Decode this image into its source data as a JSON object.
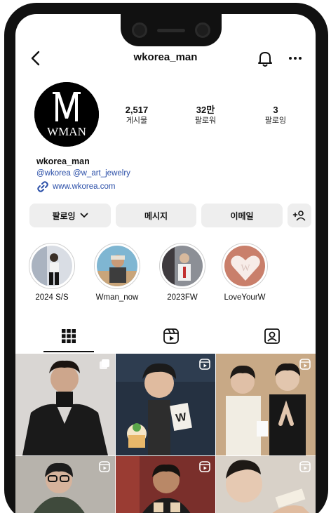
{
  "header": {
    "handle": "wkorea_man"
  },
  "profile": {
    "logo_text": "WMAN",
    "stats": [
      {
        "value": "2,517",
        "label": "게시물"
      },
      {
        "value": "32만",
        "label": "팔로워"
      },
      {
        "value": "3",
        "label": "팔로잉"
      }
    ],
    "name": "wkorea_man",
    "tags": "@wkorea @w_art_jewelry",
    "link": "www.wkorea.com"
  },
  "actions": {
    "following_label": "팔로잉",
    "message_label": "메시지",
    "email_label": "이메일"
  },
  "highlights": [
    {
      "label": "2024 S/S"
    },
    {
      "label": "Wman_now"
    },
    {
      "label": "2023FW"
    },
    {
      "label": "LoveYourW"
    }
  ],
  "grid_posts": [
    {
      "type": "carousel",
      "icon": "carousel-icon"
    },
    {
      "type": "reel",
      "icon": "reels-icon"
    },
    {
      "type": "reel",
      "icon": "reels-icon"
    },
    {
      "type": "reel",
      "icon": "reels-icon"
    },
    {
      "type": "reel",
      "icon": "reels-icon"
    },
    {
      "type": "reel",
      "icon": "reels-icon"
    }
  ]
}
